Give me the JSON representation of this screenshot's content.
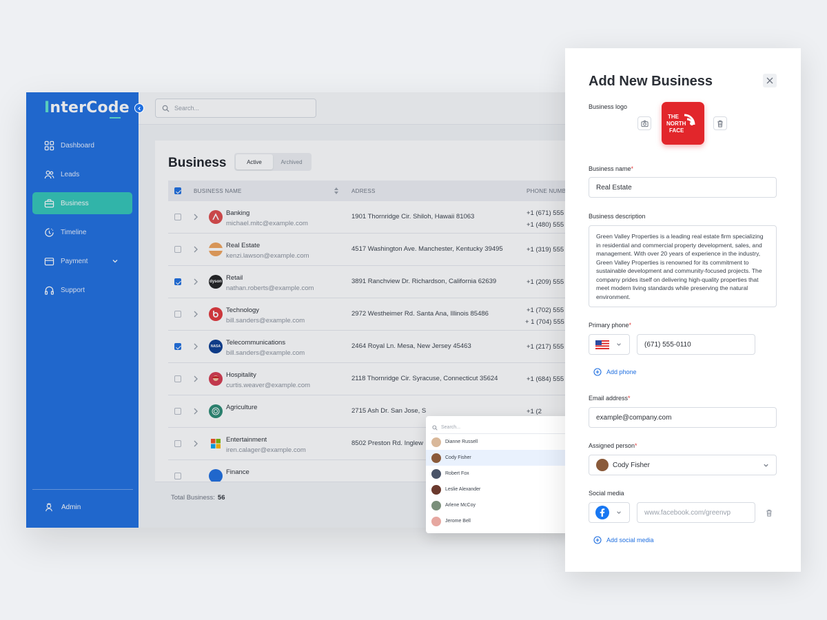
{
  "app": {
    "logo_first": "I",
    "logo_rest": "nterCode",
    "search_placeholder": "Search..."
  },
  "sidebar": {
    "items": [
      {
        "label": "Dashboard",
        "icon": "grid-icon"
      },
      {
        "label": "Leads",
        "icon": "users-icon"
      },
      {
        "label": "Business",
        "icon": "briefcase-icon",
        "active": true
      },
      {
        "label": "Timeline",
        "icon": "clock-icon"
      },
      {
        "label": "Payment",
        "icon": "wallet-icon",
        "has_submenu": true
      },
      {
        "label": "Support",
        "icon": "headphones-icon"
      }
    ],
    "admin_label": "Admin"
  },
  "business": {
    "title": "Business",
    "tabs": [
      {
        "label": "Active",
        "selected": true
      },
      {
        "label": "Archived"
      }
    ],
    "columns": [
      "BUSINESS NAME",
      "ADRESS",
      "PHONE NUMB"
    ],
    "rows": [
      {
        "name": "Banking",
        "email": "michael.mitc@example.com",
        "address": "1901 Thornridge Cir. Shiloh, Hawaii 81063",
        "phones": [
          "+1 (671) 555",
          "+1 (480) 555"
        ],
        "checked": false
      },
      {
        "name": "Real Estate",
        "email": "kenzi.lawson@example.com",
        "address": "4517 Washington Ave. Manchester, Kentucky 39495",
        "phones": [
          "+1 (319) 555"
        ],
        "checked": false
      },
      {
        "name": "Retail",
        "email": "nathan.roberts@example.com",
        "address": "3891 Ranchview Dr. Richardson, California 62639",
        "phones": [
          "+1 (209) 555"
        ],
        "checked": true
      },
      {
        "name": "Technology",
        "email": "bill.sanders@example.com",
        "address": "2972 Westheimer Rd. Santa Ana, Illinois 85486",
        "phones": [
          "+1 (702) 555",
          "+ 1 (704) 555"
        ],
        "checked": false
      },
      {
        "name": "Telecommunications",
        "email": "bill.sanders@example.com",
        "address": "2464 Royal Ln. Mesa, New Jersey 45463",
        "phones": [
          "+1 (217) 555"
        ],
        "checked": true
      },
      {
        "name": "Hospitality",
        "email": "curtis.weaver@example.com",
        "address": "2118 Thornridge Cir. Syracuse, Connecticut 35624",
        "phones": [
          "+1 (684) 555"
        ],
        "checked": false
      },
      {
        "name": "Agriculture",
        "email": "",
        "address": "2715 Ash Dr. San Jose, S",
        "phones": [
          "+1 (2"
        ],
        "checked": false
      },
      {
        "name": "Entertainment",
        "email": "iren.calager@example.com",
        "address": "8502 Preston Rd. Inglew",
        "phones": [
          ""
        ],
        "checked": false
      },
      {
        "name": "Finance",
        "email": "",
        "address": "",
        "phones": [
          ""
        ],
        "checked": false
      }
    ],
    "total_label": "Total Business:",
    "total_value": "56",
    "logo_texts": {
      "retail": "dyson",
      "telecom": "NASA"
    }
  },
  "dropdown": {
    "search_placeholder": "Search...",
    "people": [
      {
        "name": "Dianne Russell"
      },
      {
        "name": "Cody Fisher",
        "selected": true
      },
      {
        "name": "Robert Fox"
      },
      {
        "name": "Leslie Alexander"
      },
      {
        "name": "Arlene McCoy"
      },
      {
        "name": "Jerome Bell"
      }
    ]
  },
  "panel": {
    "title": "Add New Business",
    "logo_label": "Business logo",
    "logo_text_1": "THE",
    "logo_text_2": "NORTH",
    "logo_text_3": "FACE",
    "name_label": "Business name",
    "name_value": "Real Estate",
    "desc_label": "Business description",
    "desc_value": "Green Valley Properties is a leading real estate firm specializing in residential and commercial property development, sales, and management. With over 20 years of experience in the industry, Green Valley Properties is renowned for its commitment to sustainable development and community-focused projects. The company prides itself on delivering high-quality properties that meet modern living standards while preserving the natural environment.",
    "phone_label": "Primary phone",
    "phone_value": "(671) 555-0110",
    "add_phone": "Add phone",
    "email_label": "Email address",
    "email_value": "example@company.com",
    "assigned_label": "Assigned person",
    "assigned_value": "Cody Fisher",
    "social_label": "Social media",
    "social_placeholder": "www.facebook.com/greenvp",
    "add_social": "Add social media",
    "required_mark": "*"
  },
  "colors": {
    "sidebar": "#1f6fe0",
    "accent": "#33c6b8",
    "logo_red": "#e2262b",
    "link": "#1f6fe0"
  }
}
